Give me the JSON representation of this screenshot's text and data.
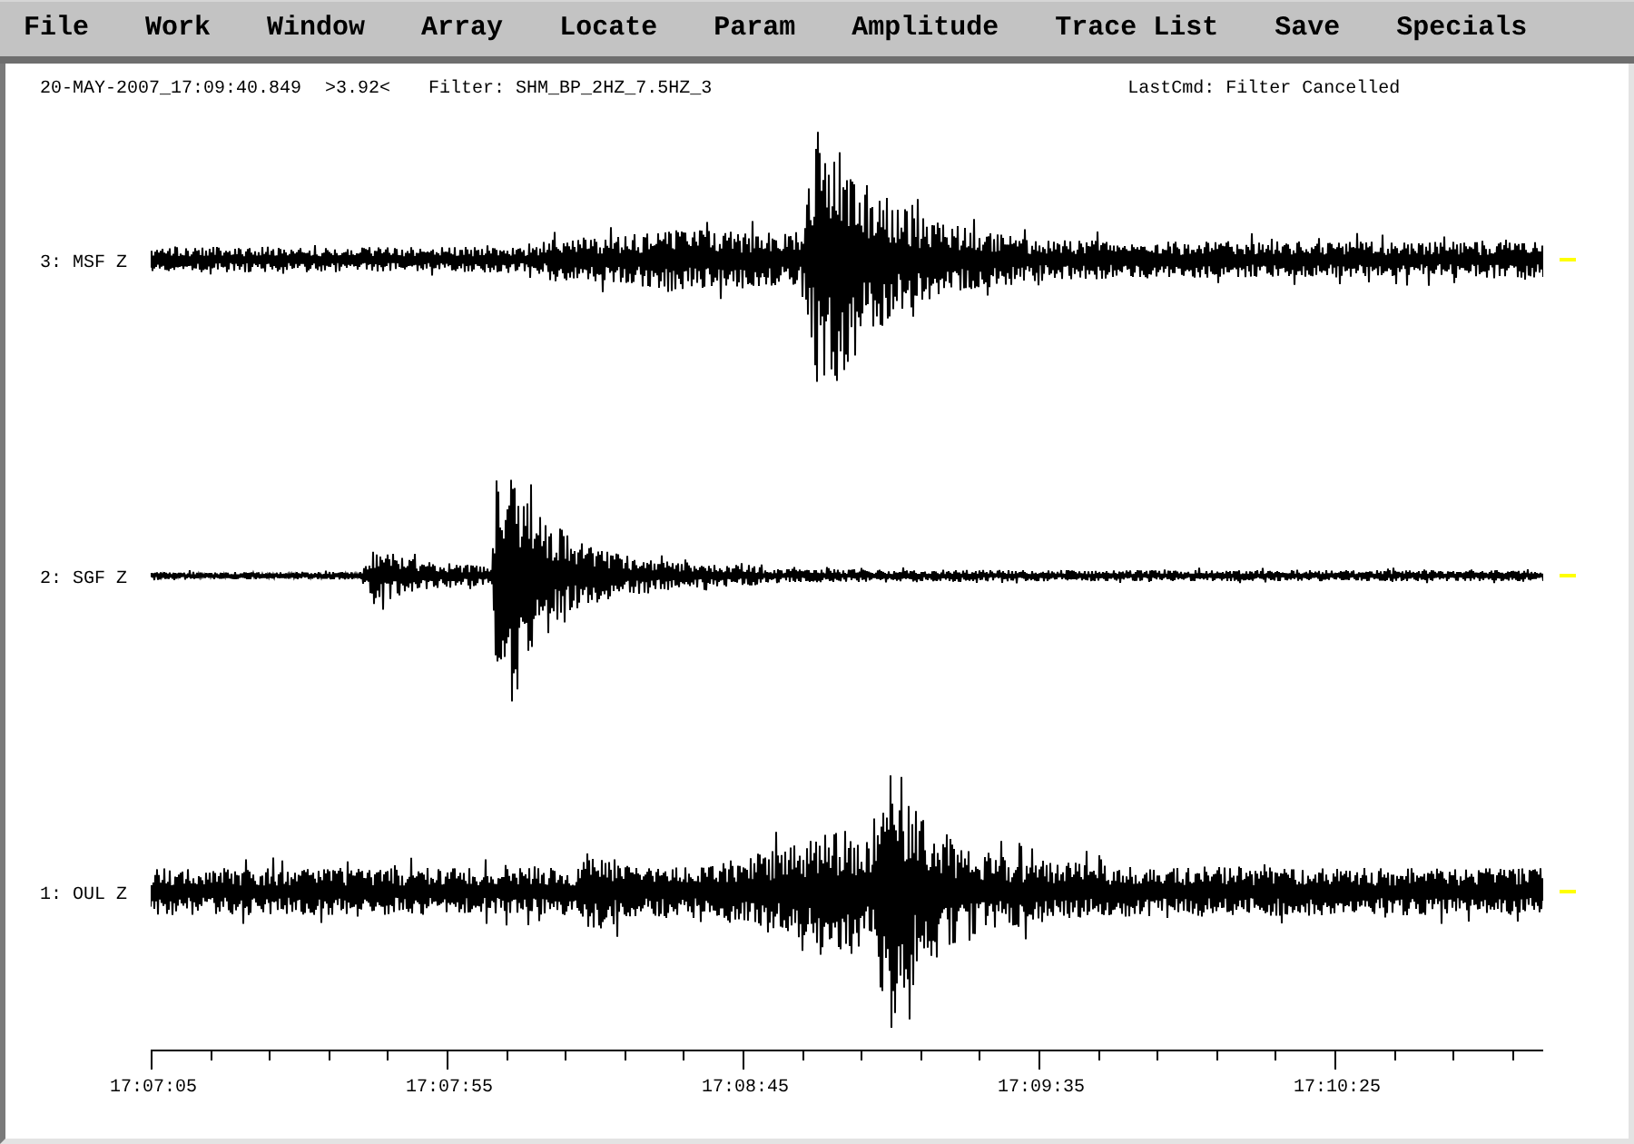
{
  "menu": [
    "File",
    "Work",
    "Window",
    "Array",
    "Locate",
    "Param",
    "Amplitude",
    "Trace List",
    "Save",
    "Specials"
  ],
  "status": {
    "timestamp": "20-MAY-2007_17:09:40.849",
    "readout": ">3.92<",
    "filter": "Filter: SHM_BP_2HZ_7.5HZ_3",
    "last_command": "LastCmd: Filter Cancelled"
  },
  "traces": [
    {
      "label": "3: MSF Z"
    },
    {
      "label": "2: SGF Z"
    },
    {
      "label": "1: OUL Z"
    }
  ],
  "time_axis": {
    "ticks": [
      "17:07:05",
      "17:07:55",
      "17:08:45",
      "17:09:35",
      "17:10:25"
    ]
  }
}
